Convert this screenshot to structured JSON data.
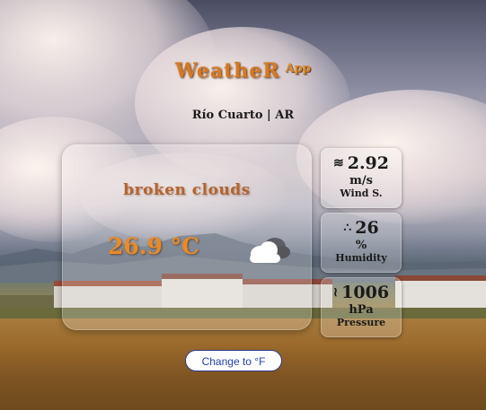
{
  "app": {
    "logo_main": "WeatheR",
    "logo_suffix": "App"
  },
  "location": "Río Cuarto | AR",
  "current": {
    "description": "broken clouds",
    "temperature": "26.9 °C",
    "icon": "broken-clouds-icon"
  },
  "stats": {
    "wind": {
      "icon": "wind-icon",
      "value": "2.92",
      "unit": "m/s",
      "label": "Wind S."
    },
    "humidity": {
      "icon": "humidity-icon",
      "value": "26",
      "unit": "%",
      "label": "Humidity"
    },
    "pressure": {
      "icon": "pressure-icon",
      "value": "1006",
      "unit": "hPa",
      "label": "Pressure"
    }
  },
  "toggle_button": "Change to °F",
  "colors": {
    "accent": "#ee8a22",
    "description": "#b9622a",
    "button_text": "#1f3fae"
  }
}
